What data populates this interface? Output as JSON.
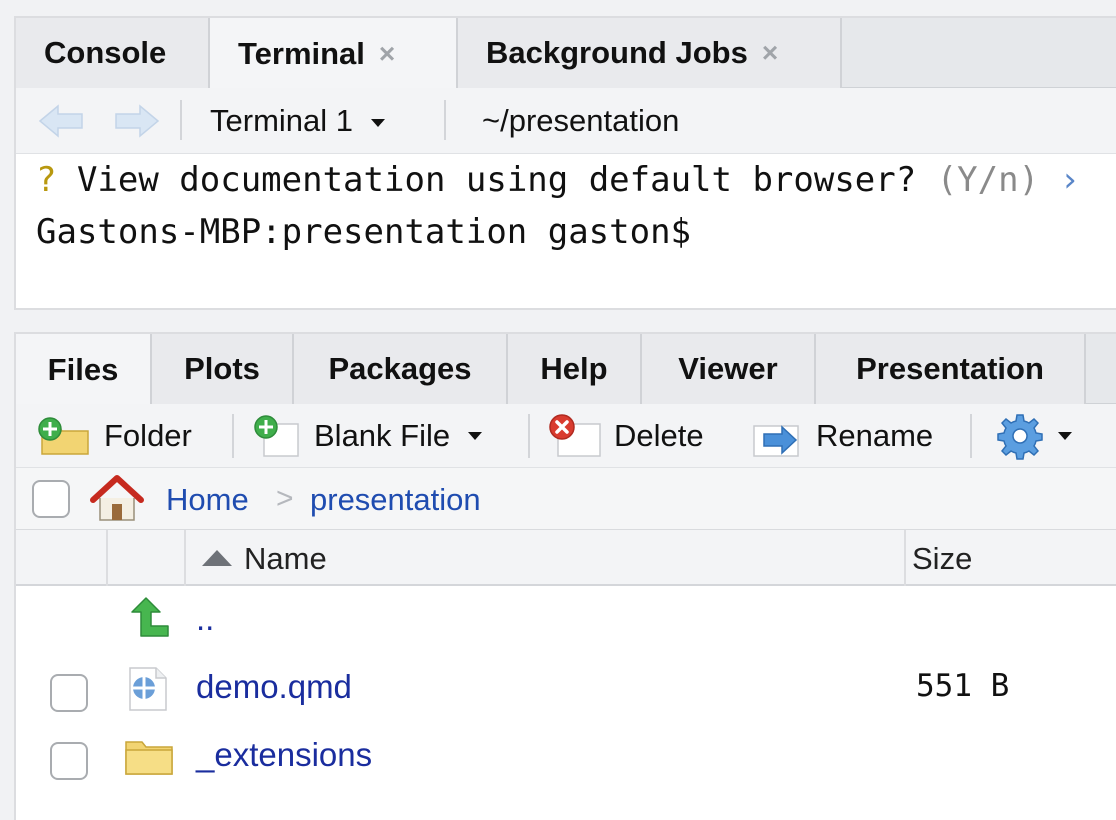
{
  "terminal_pane": {
    "tabs": [
      {
        "label": "Console",
        "closable": false,
        "active": false
      },
      {
        "label": "Terminal",
        "closable": true,
        "active": true
      },
      {
        "label": "Background Jobs",
        "closable": true,
        "active": false
      }
    ],
    "close_glyph": "×",
    "toolbar": {
      "session_label": "Terminal 1",
      "path": "~/presentation"
    },
    "lines": {
      "line1_prefix": "?",
      "line1_text": " View documentation using default browser? ",
      "line1_hint": "(Y/n)",
      "line1_more": " ›",
      "line2_text": "Gastons-MBP:presentation gaston$"
    }
  },
  "files_pane": {
    "tabs": [
      {
        "label": "Files",
        "active": true
      },
      {
        "label": "Plots",
        "active": false
      },
      {
        "label": "Packages",
        "active": false
      },
      {
        "label": "Help",
        "active": false
      },
      {
        "label": "Viewer",
        "active": false
      },
      {
        "label": "Presentation",
        "active": false
      }
    ],
    "toolbar": {
      "folder_label": "Folder",
      "blank_file_label": "Blank File",
      "delete_label": "Delete",
      "rename_label": "Rename"
    },
    "breadcrumb": {
      "home": "Home",
      "separator": ">",
      "current": "presentation"
    },
    "columns": {
      "name": "Name",
      "size": "Size"
    },
    "rows": [
      {
        "name": "..",
        "size": "",
        "icon": "up-arrow-icon",
        "has_checkbox": false
      },
      {
        "name": "demo.qmd",
        "size": "551 B",
        "icon": "quarto-file-icon",
        "has_checkbox": true
      },
      {
        "name": "_extensions",
        "size": "",
        "icon": "folder-icon",
        "has_checkbox": true
      }
    ]
  },
  "colors": {
    "link": "#1f4cb0",
    "file_link": "#1a2d9e",
    "prompt_question": "#b8980f",
    "gear": "#4a90d9"
  }
}
